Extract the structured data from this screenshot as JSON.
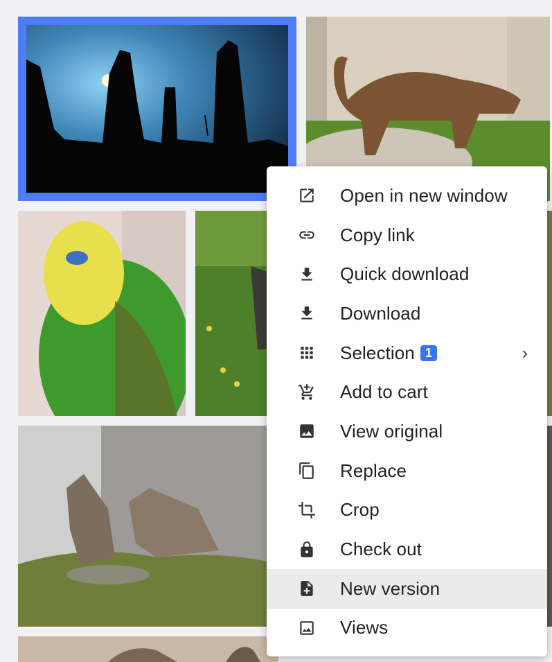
{
  "menu": {
    "items": [
      {
        "label": "Open in new window",
        "icon": "open-new-window-icon"
      },
      {
        "label": "Copy link",
        "icon": "link-icon"
      },
      {
        "label": "Quick download",
        "icon": "download-icon"
      },
      {
        "label": "Download",
        "icon": "download-icon"
      },
      {
        "label": "Selection",
        "icon": "grid-icon",
        "badge": "1",
        "submenu": "›"
      },
      {
        "label": "Add to cart",
        "icon": "add-cart-icon"
      },
      {
        "label": "View original",
        "icon": "image-icon"
      },
      {
        "label": "Replace",
        "icon": "copy-icon"
      },
      {
        "label": "Crop",
        "icon": "crop-icon"
      },
      {
        "label": "Check out",
        "icon": "lock-icon"
      },
      {
        "label": "New version",
        "icon": "file-add-icon",
        "highlighted": true
      },
      {
        "label": "Views",
        "icon": "image-outline-icon"
      }
    ]
  },
  "colors": {
    "selection_border": "#4f7cf7",
    "badge": "#3b74f2",
    "hover_row": "#ebebeb"
  }
}
